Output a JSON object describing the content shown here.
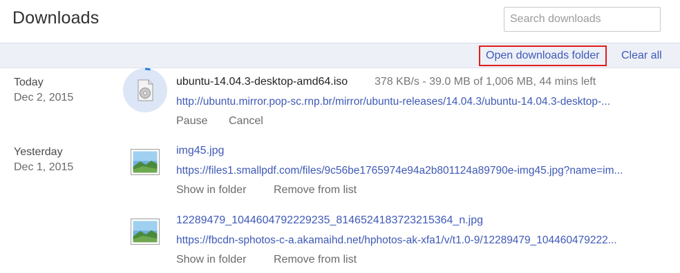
{
  "header": {
    "title": "Downloads",
    "search_placeholder": "Search downloads"
  },
  "actions": {
    "open_folder": "Open downloads folder",
    "clear_all": "Clear all"
  },
  "groups": [
    {
      "day": "Today",
      "date": "Dec 2, 2015"
    },
    {
      "day": "Yesterday",
      "date": "Dec 1, 2015"
    }
  ],
  "downloads": [
    {
      "file_name": "ubuntu-14.04.3-desktop-amd64.iso",
      "status": "378 KB/s - 39.0 MB of 1,006 MB, 44 mins left",
      "url": "http://ubuntu.mirror.pop-sc.rnp.br/mirror/ubuntu-releases/14.04.3/ubuntu-14.04.3-desktop-...",
      "actions": [
        "Pause",
        "Cancel"
      ],
      "icon": "disc-icon",
      "progress": 0.039
    },
    {
      "file_name": "img45.jpg",
      "url": "https://files1.smallpdf.com/files/9c56be1765974e94a2b801124a89790e-img45.jpg?name=im...",
      "actions": [
        "Show in folder",
        "Remove from list"
      ],
      "icon": "image-file-icon"
    },
    {
      "file_name": "12289479_1044604792229235_8146524183723215364_n.jpg",
      "url": "https://fbcdn-sphotos-c-a.akamaihd.net/hphotos-ak-xfa1/v/t1.0-9/12289479_104460479222...",
      "actions": [
        "Show in folder",
        "Remove from list"
      ],
      "icon": "image-file-icon"
    }
  ],
  "colors": {
    "link": "#3e59b6",
    "action_bar_bg": "#edf0f7",
    "highlight_border": "#e31c1c",
    "progress_ring": "#2a7de1"
  }
}
